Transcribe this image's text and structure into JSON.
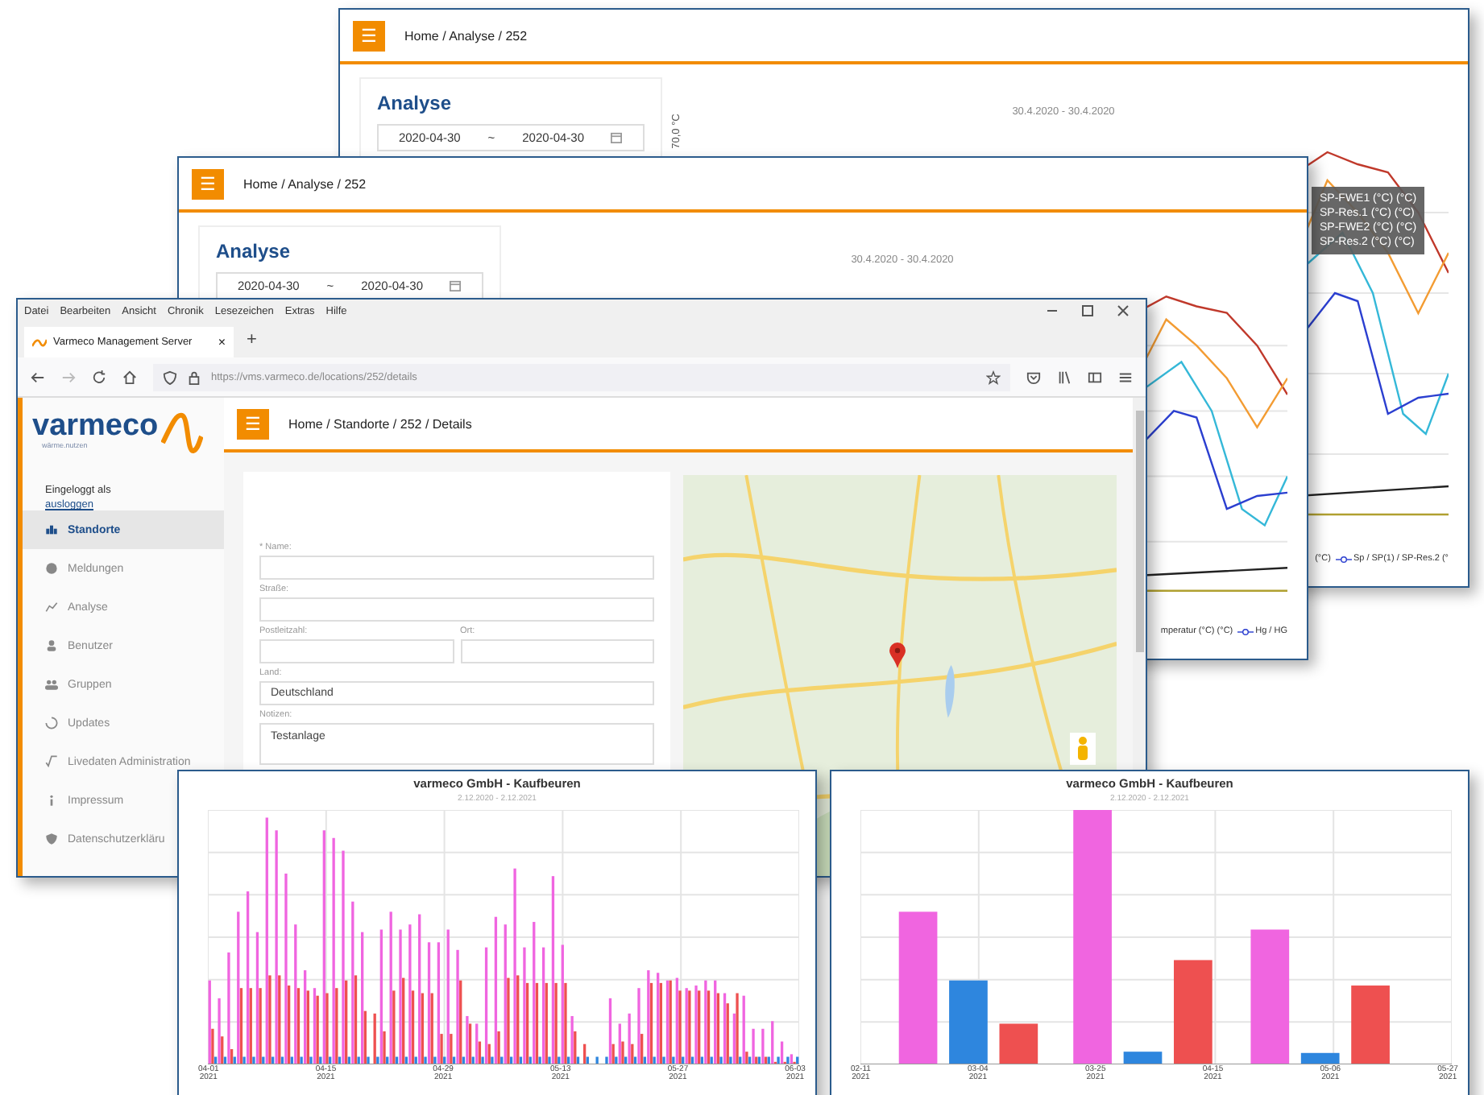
{
  "analysis_windows": [
    {
      "menu_icon": "☰",
      "breadcrumb": "Home / Analyse / 252",
      "title": "Analyse",
      "date_from": "2020-04-30",
      "date_separator": "~",
      "date_to": "2020-04-30",
      "chart_subtitle": "30.4.2020 - 30.4.2020",
      "y_label": "70,0 °C",
      "tooltip": [
        "SP-FWE1 (°C) (°C)",
        "SP-Res.1 (°C) (°C)",
        "SP-FWE2 (°C) (°C)",
        "SP-Res.2 (°C) (°C)"
      ],
      "legend": [
        {
          "label": "(°C)"
        },
        {
          "label": "Sp / SP(1) / SP-Res.2 (°"
        }
      ]
    },
    {
      "menu_icon": "☰",
      "breadcrumb": "Home / Analyse / 252",
      "title": "Analyse",
      "date_from": "2020-04-30",
      "date_separator": "~",
      "date_to": "2020-04-30",
      "chart_subtitle": "30.4.2020 - 30.4.2020",
      "legend": [
        {
          "label": "mperatur (°C) (°C)"
        },
        {
          "label": "Hg / HG"
        }
      ]
    }
  ],
  "browser": {
    "menu": [
      "Datei",
      "Bearbeiten",
      "Ansicht",
      "Chronik",
      "Lesezeichen",
      "Extras",
      "Hilfe"
    ],
    "tab_title": "Varmeco Management Server",
    "tab_close": "×",
    "new_tab": "+",
    "url": "https://vms.varmeco.de/locations/252/details",
    "logo": "varmeco",
    "tagline": "wärme.nutzen",
    "logged_in_label": "Eingeloggt als",
    "logout_link": "ausloggen",
    "nav": [
      {
        "label": "Standorte",
        "selected": true
      },
      {
        "label": "Meldungen",
        "selected": false
      },
      {
        "label": "Analyse",
        "selected": false
      },
      {
        "label": "Benutzer",
        "selected": false
      },
      {
        "label": "Gruppen",
        "selected": false
      },
      {
        "label": "Updates",
        "selected": false
      },
      {
        "label": "Livedaten Administration",
        "selected": false
      },
      {
        "label": "Impressum",
        "selected": false
      },
      {
        "label": "Datenschutzerkläru",
        "selected": false
      }
    ],
    "menu_icon": "☰",
    "breadcrumb": "Home / Standorte / 252 / Details",
    "form_rows": [
      [
        {
          "label": "* Name:",
          "kind": "text"
        }
      ],
      [
        {
          "label": "Straße:",
          "kind": "text"
        }
      ],
      [
        {
          "label": "Postleitzahl:",
          "kind": "text"
        },
        {
          "label": "Ort:",
          "kind": "text"
        }
      ],
      [
        {
          "label": "Land:",
          "kind": "text",
          "value": "Deutschland"
        }
      ],
      [
        {
          "label": "Notizen:",
          "kind": "textarea",
          "value": "Testanlage"
        }
      ]
    ]
  },
  "energy_charts": [
    {
      "kind": "daily",
      "title": "varmeco GmbH - Kaufbeuren",
      "subtitle": "2.12.2020 - 2.12.2021",
      "x_labels": [
        {
          "date": "04-01",
          "year": "2021"
        },
        {
          "date": "04-15",
          "year": "2021"
        },
        {
          "date": "04-29",
          "year": "2021"
        },
        {
          "date": "05-13",
          "year": "2021"
        },
        {
          "date": "05-27",
          "year": "2021"
        },
        {
          "date": "06-03",
          "year": "2021"
        }
      ]
    },
    {
      "kind": "weekly",
      "title": "varmeco GmbH - Kaufbeuren",
      "subtitle": "2.12.2020 - 2.12.2021",
      "x_labels": [
        {
          "date": "02-11",
          "year": "2021"
        },
        {
          "date": "03-04",
          "year": "2021"
        },
        {
          "date": "03-25",
          "year": "2021"
        },
        {
          "date": "04-15",
          "year": "2021"
        },
        {
          "date": "05-06",
          "year": "2021"
        },
        {
          "date": "05-27",
          "year": "2021"
        }
      ]
    }
  ]
}
